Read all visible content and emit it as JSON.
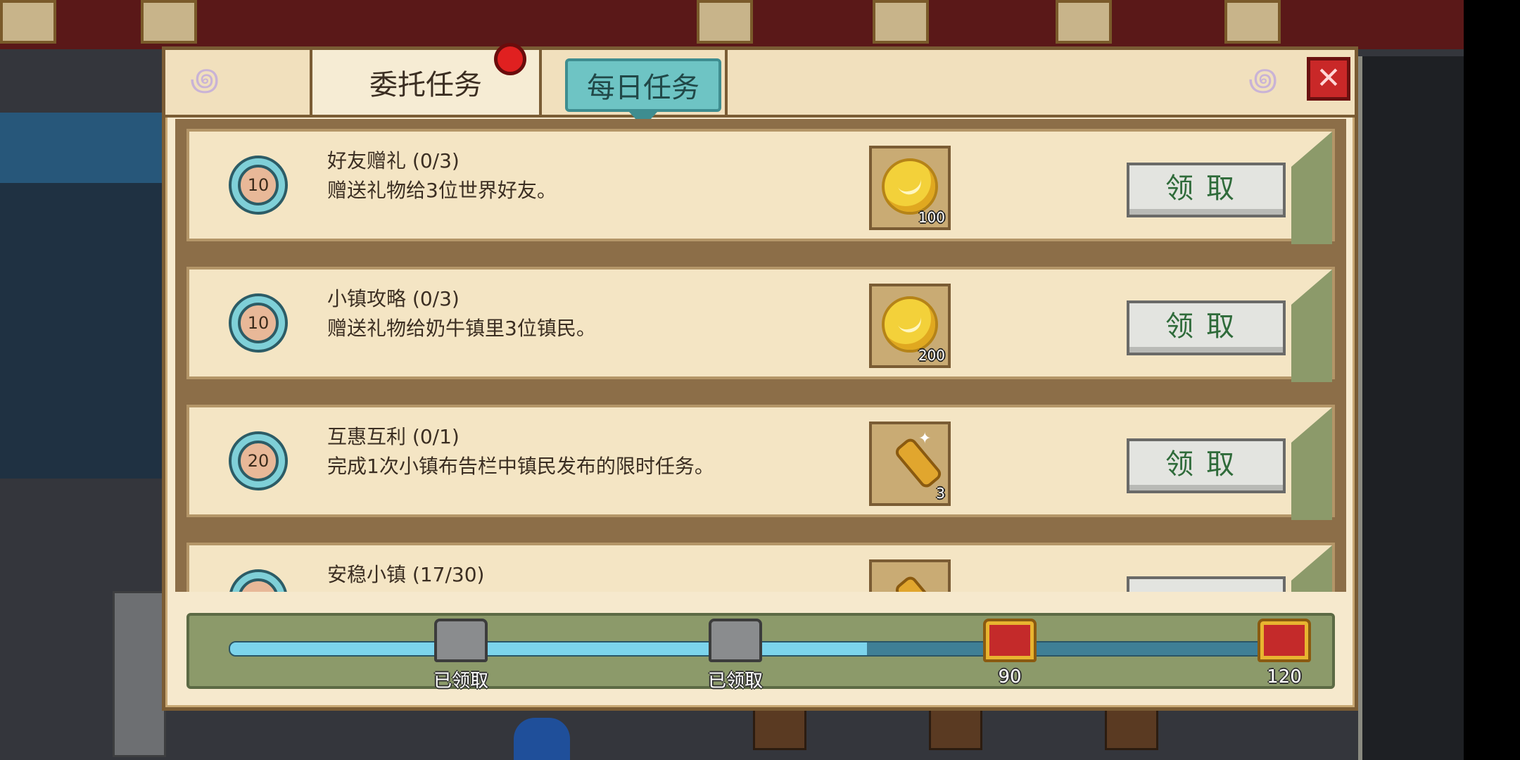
{
  "tabs": {
    "commission": "委托任务",
    "daily": "每日任务"
  },
  "tasks": [
    {
      "points": "10",
      "title": "好友赠礼 (0/3)",
      "desc": "赠送礼物给3位世界好友。",
      "reward_icon": "gold-coin-icon",
      "reward_count": "100",
      "button": "领取"
    },
    {
      "points": "10",
      "title": "小镇攻略 (0/3)",
      "desc": "赠送礼物给奶牛镇里3位镇民。",
      "reward_icon": "gold-coin-icon",
      "reward_count": "200",
      "button": "领取"
    },
    {
      "points": "20",
      "title": "互惠互利 (0/1)",
      "desc": "完成1次小镇布告栏中镇民发布的限时任务。",
      "reward_icon": "gold-scroll-icon",
      "reward_count": "3",
      "button": "领取"
    },
    {
      "points": "",
      "title": "安稳小镇 (17/30)",
      "desc": "",
      "reward_icon": "gold-scroll-icon",
      "reward_count": "",
      "button": ""
    }
  ],
  "progress": {
    "fill_fraction": 0.6,
    "milestones": [
      {
        "label": "已领取",
        "state": "claimed"
      },
      {
        "label": "已领取",
        "state": "claimed"
      },
      {
        "label": "90",
        "state": "locked"
      },
      {
        "label": "120",
        "state": "locked"
      }
    ]
  },
  "colors": {
    "panel_bg": "#f6e9cd",
    "frame_brown": "#7a5c34",
    "tab_active": "#6ec4c4",
    "claim_text": "#2f6b3a",
    "close_red": "#c92828",
    "progress_fill": "#7cd4ec"
  }
}
